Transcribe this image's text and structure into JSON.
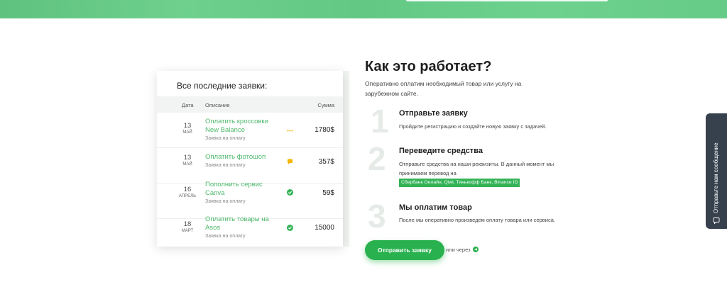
{
  "orders_card": {
    "title": "Все последние заявки:",
    "headers": {
      "date": "Дата",
      "description": "Описание",
      "amount": "Сумма"
    },
    "rows": [
      {
        "day": "13",
        "month": "май",
        "name": "Оплатить кроссовки New Balance",
        "status_text": "Заявка на оплату",
        "amount": "1780$",
        "status": "pending"
      },
      {
        "day": "13",
        "month": "май",
        "name": "Оплатить фотошоп",
        "status_text": "Заявка на оплату",
        "amount": "357$",
        "status": "comment"
      },
      {
        "day": "16",
        "month": "апрель",
        "name": "Пополнить сервис Canva",
        "status_text": "Заявка на оплату",
        "amount": "59$",
        "status": "done"
      },
      {
        "day": "18",
        "month": "март",
        "name": "Оплатить товары на Asos",
        "status_text": "Заявка на оплату",
        "amount": "15000",
        "status": "done"
      }
    ]
  },
  "how_it_works": {
    "title": "Как это работает?",
    "subtitle": "Оперативно оплатим необходимый товар или услугу на зарубежном сайте.",
    "steps": [
      {
        "num": "1",
        "title": "Отправьте заявку",
        "text": "Пройдите регистрацию и создайте новую заявку с задачей."
      },
      {
        "num": "2",
        "title": "Переведите средства",
        "text": "Отправьте средства на наши реквизиты. В данный момент мы принимаем перевод на",
        "highlight": "Сбербанк Онлайн, Qiwi, Тинькофф Банк, Binance ID"
      },
      {
        "num": "3",
        "title": "Мы оплатим товар",
        "text": "После мы оперативно произведем оплату товара или сервиса."
      }
    ],
    "cta_label": "Отправить заявку",
    "or_via": "или через",
    "or_via_icon": "telegram-icon"
  },
  "chat_widget": {
    "label": "Отправьте нам сообщение",
    "icon": "chat-bubble-icon"
  },
  "colors": {
    "brand_green": "#28b14e",
    "link_green": "#4cb86a",
    "banner_green": "#67cb88",
    "pending_yellow": "#f5b300",
    "chat_bg": "#37414e"
  }
}
